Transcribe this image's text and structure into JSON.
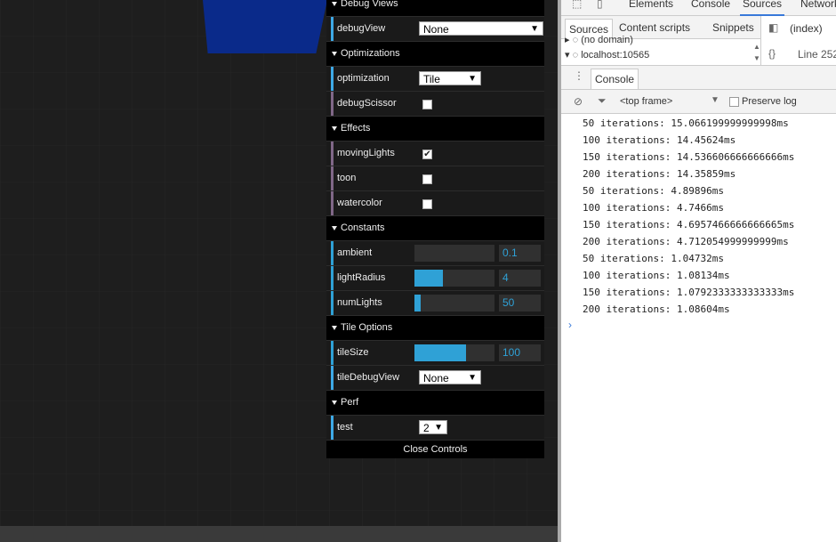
{
  "gui": {
    "folders": [
      {
        "title": "Debug Views",
        "rows": [
          {
            "label": "debugView",
            "type": "select",
            "value": "None"
          }
        ]
      },
      {
        "title": "Optimizations",
        "rows": [
          {
            "label": "optimization",
            "type": "select",
            "value": "Tile"
          },
          {
            "label": "debugScissor",
            "type": "checkbox",
            "checked": false
          }
        ]
      },
      {
        "title": "Effects",
        "rows": [
          {
            "label": "movingLights",
            "type": "checkbox",
            "checked": true
          },
          {
            "label": "toon",
            "type": "checkbox",
            "checked": false
          },
          {
            "label": "watercolor",
            "type": "checkbox",
            "checked": false
          }
        ]
      },
      {
        "title": "Constants",
        "rows": [
          {
            "label": "ambient",
            "type": "number",
            "value": "0.1",
            "level": 0.0
          },
          {
            "label": "lightRadius",
            "type": "number",
            "value": "4",
            "level": 0.36
          },
          {
            "label": "numLights",
            "type": "number",
            "value": "50",
            "level": 0.08
          }
        ]
      },
      {
        "title": "Tile Options",
        "rows": [
          {
            "label": "tileSize",
            "type": "number",
            "value": "100",
            "level": 0.64
          },
          {
            "label": "tileDebugView",
            "type": "select",
            "value": "None"
          }
        ]
      },
      {
        "title": "Perf",
        "rows": [
          {
            "label": "test",
            "type": "select",
            "value": "2"
          }
        ]
      }
    ],
    "close_label": "Close Controls"
  },
  "devtools": {
    "tabs": [
      "Elements",
      "Console",
      "Sources",
      "Network"
    ],
    "active_tab": "Sources",
    "subtabs": [
      "Sources",
      "Content scripts",
      "Snippets"
    ],
    "tree": {
      "item1": "(no domain)",
      "item2": "localhost:10565"
    },
    "file_label": "(index)",
    "line_label": "Line 252",
    "console_tab": "Console",
    "frame_label": "<top frame>",
    "preserve_log": "Preserve log",
    "log_lines": [
      "50 iterations: 15.066199999999998ms",
      "100 iterations: 14.45624ms",
      "150 iterations: 14.536606666666666ms",
      "200 iterations: 14.35859ms",
      "50 iterations: 4.89896ms",
      "100 iterations: 4.7466ms",
      "150 iterations: 4.6957466666666665ms",
      "200 iterations: 4.712054999999999ms",
      "50 iterations: 1.04732ms",
      "100 iterations: 1.08134ms",
      "150 iterations: 1.0792333333333333ms",
      "200 iterations: 1.08604ms"
    ]
  }
}
